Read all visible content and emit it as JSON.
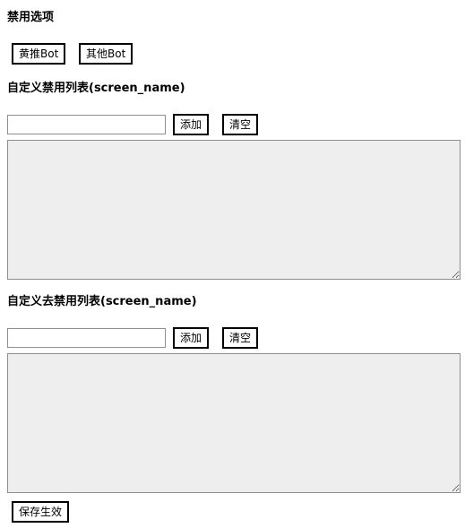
{
  "ban_options": {
    "title": "禁用选项",
    "yellow_bot_label": "黄推Bot",
    "other_bot_label": "其他Bot"
  },
  "custom_ban_list": {
    "title": "自定义禁用列表(screen_name)",
    "input_value": "",
    "add_label": "添加",
    "clear_label": "清空",
    "list_value": ""
  },
  "custom_unban_list": {
    "title": "自定义去禁用列表(screen_name)",
    "input_value": "",
    "add_label": "添加",
    "clear_label": "清空",
    "list_value": ""
  },
  "save_label": "保存生效"
}
